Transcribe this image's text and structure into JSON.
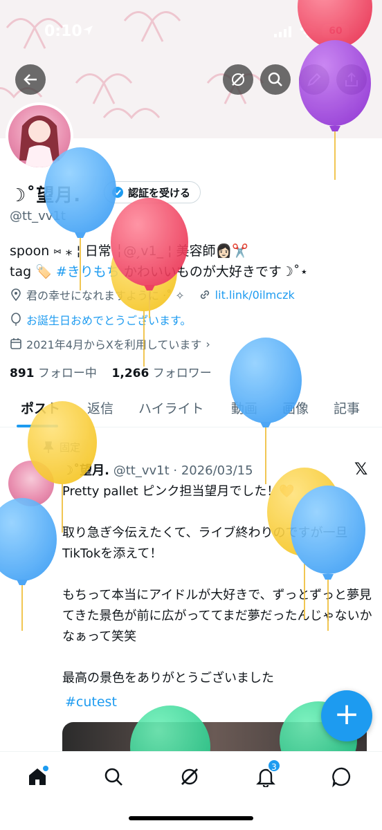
{
  "status": {
    "time": "0:10",
    "battery": "60"
  },
  "profile": {
    "name": "☽˚望月.",
    "verify_button": "認証を受ける",
    "handle": "@tt_vv1t",
    "bio_line1": "spoon ⑅ ⁎ ¦ 日常 ╎@ ̗v1_ ¦ 美容師👩🏻✂️",
    "bio_line2_prefix": "tag 🏷️ ",
    "bio_line2_link": "#きりもち",
    "bio_line2_suffix": " かわいいものが大好きです☽˚⋆",
    "location": "君の幸せになれますように ‧˚ ✧",
    "website": "lit.link/0ilmczk",
    "birthday": "お誕生日おめでとうございます。",
    "joined": "2021年4月からXを利用しています",
    "following_count": "891",
    "following_label": "フォロー中",
    "followers_count": "1,266",
    "followers_label": "フォロワー"
  },
  "tabs": [
    "ポスト",
    "返信",
    "ハイライト",
    "動画",
    "画像",
    "記事"
  ],
  "post": {
    "pinned_label": "固定",
    "author": "☽˚望月.",
    "handle_date": "@tt_vv1t · 2026/03/15",
    "body": "Pretty pallet ピンク担当望月でした！🧡\n\n取り急ぎ今伝えたくて、ライブ終わりのですが一旦TikTokを添えて！\n\nもちって本当にアイドルが大好きで、ずっとずっと夢見てきた景色が前に広がっててまだ夢だったんじゃないかなぁって笑笑\n\n最高の景色をありがとうございました",
    "hashtag": "#cutest"
  },
  "nav": {
    "notifications_badge": "3"
  },
  "colors": {
    "accent": "#1d9bf0",
    "text": "#0f1419",
    "muted": "#536471"
  }
}
